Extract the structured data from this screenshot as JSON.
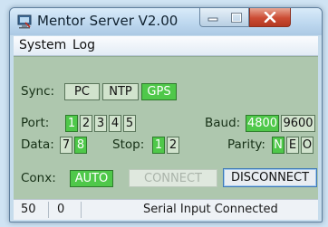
{
  "window": {
    "title": "Mentor Server V2.00"
  },
  "menu": {
    "items": [
      "System",
      "Log"
    ]
  },
  "sync": {
    "label": "Sync:",
    "options": [
      "PC",
      "NTP",
      "GPS"
    ],
    "selected": "GPS"
  },
  "port": {
    "label": "Port:",
    "options": [
      "1",
      "2",
      "3",
      "4",
      "5"
    ],
    "selected": "1"
  },
  "baud": {
    "label": "Baud:",
    "options": [
      "4800",
      "9600"
    ],
    "selected": "4800"
  },
  "data_bits": {
    "label": "Data:",
    "options": [
      "7",
      "8"
    ],
    "selected": "8"
  },
  "stop_bits": {
    "label": "Stop:",
    "options": [
      "1",
      "2"
    ],
    "selected": "1"
  },
  "parity": {
    "label": "Parity:",
    "options": [
      "N",
      "E",
      "O"
    ],
    "selected": "N"
  },
  "conx": {
    "label": "Conx:",
    "value": "AUTO"
  },
  "buttons": {
    "connect": "CONNECT",
    "disconnect": "DISCONNECT"
  },
  "status": {
    "count_a": "50",
    "count_b": "0",
    "message": "Serial Input Connected"
  },
  "colors": {
    "panel": "#aec7ae",
    "selected": "#4fc84a",
    "unselected": "#d1e3cd",
    "close_button": "#cc4c34"
  },
  "icons": {
    "app": "app-computer-icon",
    "minimize": "minimize-icon",
    "maximize": "maximize-icon",
    "close": "close-icon"
  }
}
